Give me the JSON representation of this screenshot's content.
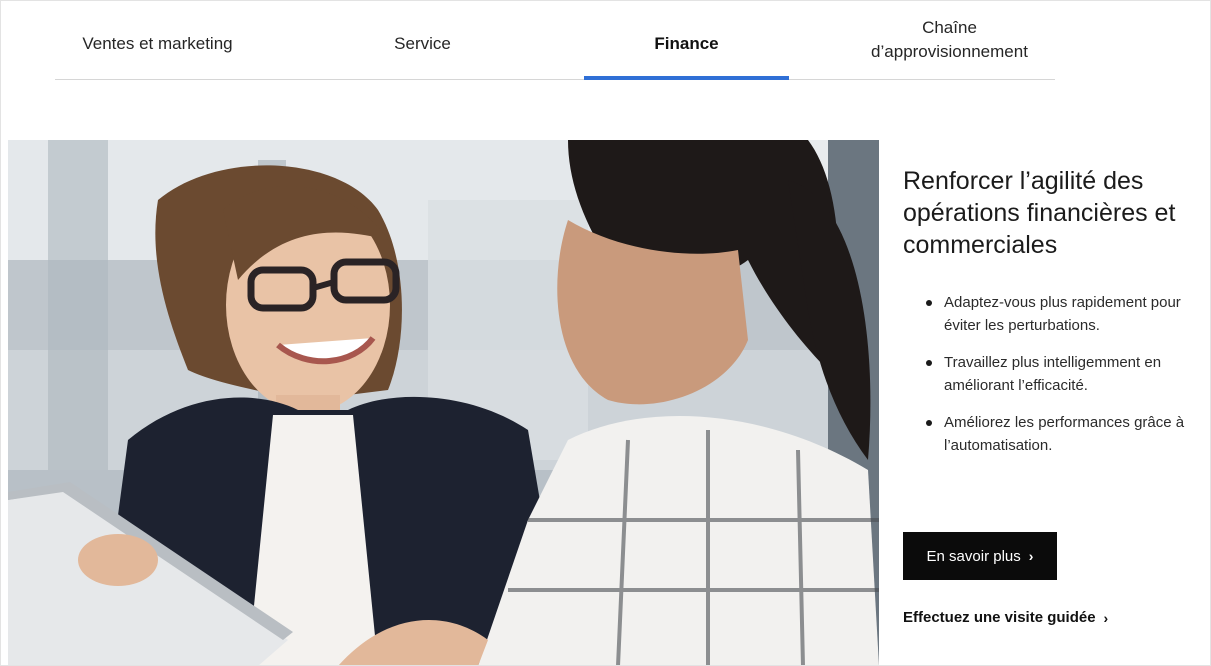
{
  "tabs": [
    {
      "label": "Ventes et marketing",
      "selected": false
    },
    {
      "label": "Service",
      "selected": false
    },
    {
      "label": "Finance",
      "selected": true
    },
    {
      "label": "Chaîne d’approvisionnement",
      "selected": false
    }
  ],
  "hero": {
    "headline": "Renforcer l’agilité des opérations financières et commerciales",
    "bullets": [
      "Adaptez-vous plus rapidement pour éviter les perturbations.",
      "Travaillez plus intelligemment en améliorant l’efficacité.",
      "Améliorez les performances grâce à l’automatisation."
    ],
    "cta_label": "En savoir plus",
    "tour_label": "Effectuez une visite guidée"
  },
  "colors": {
    "accent": "#2f6fd6",
    "cta_background": "#0b0b0b"
  },
  "icons": {
    "cta_chevron": "chevron-right-icon",
    "tour_chevron": "chevron-right-icon"
  }
}
